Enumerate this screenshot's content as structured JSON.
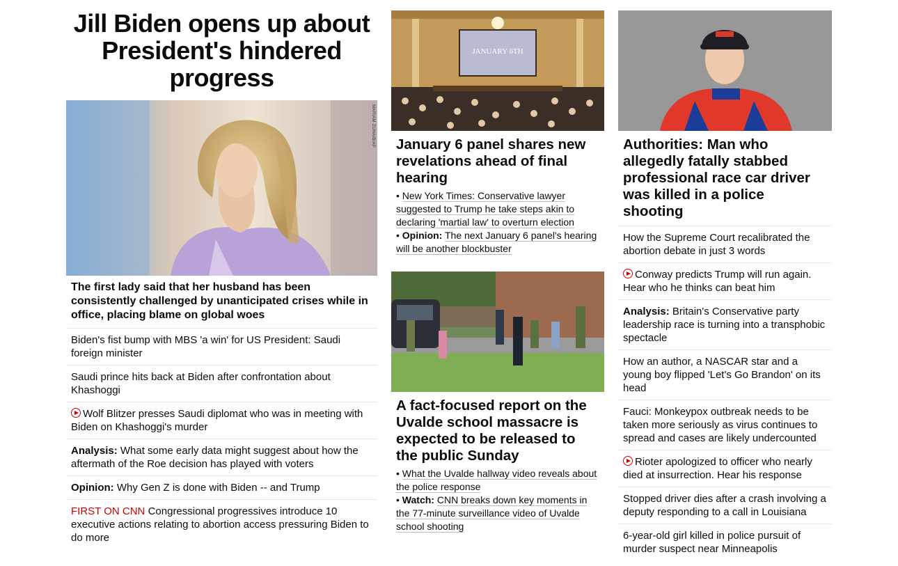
{
  "col1": {
    "headline": "Jill Biden opens up about President's hindered progress",
    "photo_alt": "Jill Biden",
    "photo_credit": "MARIAM ZUHAIB/AP",
    "lead": "The first lady said that her husband has been consistently challenged by unanticipated crises while in office, placing blame on global woes",
    "items": [
      {
        "text": "Biden's fist bump with MBS 'a win' for US President: Saudi foreign minister"
      },
      {
        "text": "Saudi prince hits back at Biden after confrontation about Khashoggi"
      },
      {
        "text": "Wolf Blitzer presses Saudi diplomat who was in meeting with Biden on Khashoggi's murder",
        "video": true
      },
      {
        "prefix": "Analysis:",
        "text": "What some early data might suggest about how the aftermath of the Roe decision has played with voters"
      },
      {
        "prefix": "Opinion:",
        "text": "Why Gen Z is done with Biden -- and Trump"
      },
      {
        "tag": "FIRST ON CNN",
        "text": "Congressional progressives introduce 10 executive actions relating to abortion access pressuring Biden to do more"
      }
    ]
  },
  "col2": {
    "story1": {
      "screen_line": "JANUARY 6TH",
      "title": "January 6 panel shares new revelations ahead of final hearing",
      "bullet1": "New York Times: Conservative lawyer suggested to Trump he take steps akin to declaring 'martial law' to overturn election",
      "bullet2_prefix": "Opinion:",
      "bullet2": "The next January 6 panel's hearing will be another blockbuster"
    },
    "story2": {
      "title": "A fact-focused report on the Uvalde school massacre is expected to be released to the public Sunday",
      "bullet1": "What the Uvalde hallway video reveals about the police response",
      "bullet2_prefix": "Watch:",
      "bullet2": "CNN breaks down key moments in the 77-minute surveillance video of Uvalde school shooting"
    }
  },
  "col3": {
    "title": "Authorities: Man who allegedly fatally stabbed professional race car driver was killed in a police shooting",
    "items": [
      {
        "text": "How the Supreme Court recalibrated the abortion debate in just 3 words"
      },
      {
        "text": "Conway predicts Trump will run again. Hear who he thinks can beat him",
        "video": true
      },
      {
        "prefix": "Analysis:",
        "text": "Britain's Conservative party leadership race is turning into a transphobic spectacle"
      },
      {
        "text": "How an author, a NASCAR star and a young boy flipped 'Let's Go Brandon' on its head"
      },
      {
        "text": "Fauci: Monkeypox outbreak needs to be taken more seriously as virus continues to spread and cases are likely undercounted"
      },
      {
        "text": "Rioter apologized to officer who nearly died at insurrection. Hear his response",
        "video": true
      },
      {
        "text": "Stopped driver dies after a crash involving a deputy responding to a call in Louisiana"
      },
      {
        "text": "6-year-old girl killed in police pursuit of murder suspect near Minneapolis"
      }
    ]
  },
  "colors": {
    "accent": "#cc0000",
    "divider": "#e6e6e6",
    "text": "#0c0c0c"
  }
}
